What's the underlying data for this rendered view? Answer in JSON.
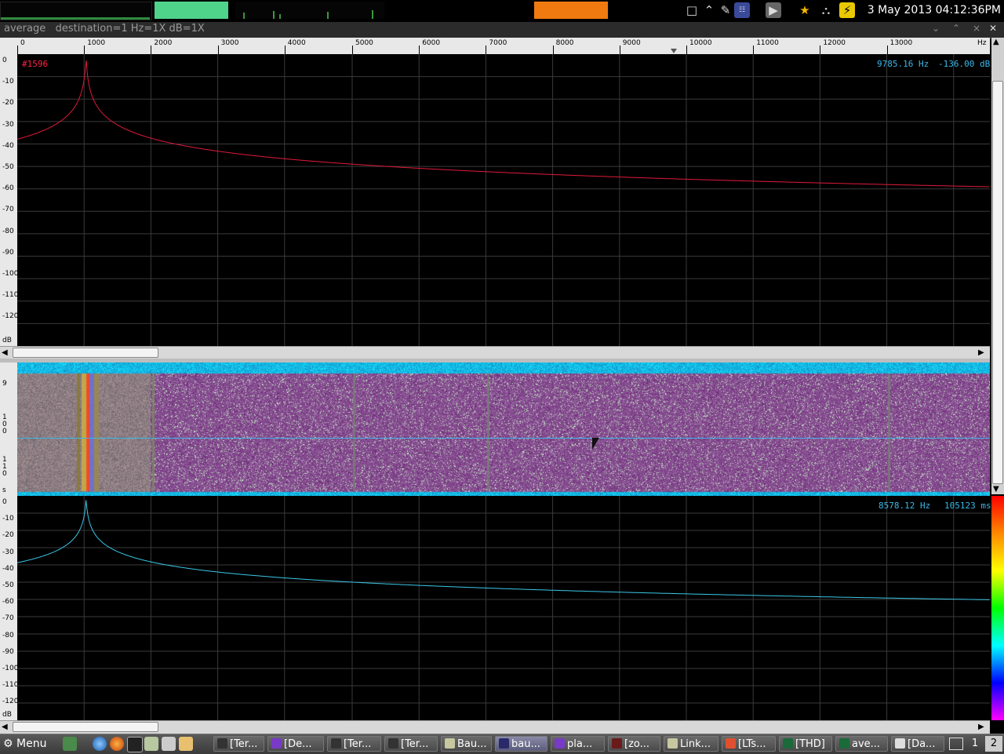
{
  "top_panel": {
    "clock": "3 May 2013 04:12:36PM",
    "tray_icons": [
      "window-icon",
      "chevron-up-icon",
      "pen-icon",
      "network-icon",
      "play-icon",
      "star-icon",
      "shield-icon",
      "power-icon"
    ],
    "accent_green": "#4fd38a",
    "accent_orange": "#f07a10"
  },
  "window": {
    "title": "average   destination=1 Hz=1X dB=1X",
    "buttons": [
      "minimize",
      "maximize",
      "close"
    ]
  },
  "spectrum_top": {
    "trace_label": "#1596",
    "readout_freq": "9785.16 Hz",
    "readout_db": "-136.00 dB",
    "x_ticks": [
      "0",
      "1000",
      "2000",
      "3000",
      "4000",
      "5000",
      "6000",
      "7000",
      "8000",
      "9000",
      "10000",
      "11000",
      "12000",
      "13000"
    ],
    "x_unit": "Hz",
    "y_ticks": [
      "0",
      "-10",
      "-20",
      "-30",
      "-40",
      "-50",
      "-60",
      "-70",
      "-80",
      "-90",
      "-100",
      "-110",
      "-120"
    ],
    "y_unit": "dB",
    "trace_color": "#e01a3a"
  },
  "waterfall": {
    "y_ticks_a": [
      "9",
      "1\n0\n0",
      "1\n1\n0"
    ],
    "y_unit": "s"
  },
  "spectrum_bottom": {
    "readout_freq": "8578.12 Hz",
    "readout_time": "105123 ms",
    "y_ticks": [
      "0",
      "-10",
      "-20",
      "-30",
      "-40",
      "-50",
      "-60",
      "-70",
      "-80",
      "-90",
      "-100",
      "-110",
      "-120"
    ],
    "y_unit": "dB",
    "trace_color": "#3ac8e8"
  },
  "taskbar": {
    "menu_label": "Menu",
    "items": [
      {
        "label": "[Ter...",
        "icon": "terminal-icon"
      },
      {
        "label": "[De...",
        "icon": "play-icon"
      },
      {
        "label": "[Ter...",
        "icon": "terminal-icon"
      },
      {
        "label": "[Ter...",
        "icon": "terminal-icon"
      },
      {
        "label": "Bau...",
        "icon": "folder-icon"
      },
      {
        "label": "bau...",
        "icon": "app-icon"
      },
      {
        "label": "pla...",
        "icon": "play-icon"
      },
      {
        "label": "[zo...",
        "icon": "zotero-icon"
      },
      {
        "label": "Link...",
        "icon": "folder-icon"
      },
      {
        "label": "[LTs...",
        "icon": "browser-icon"
      },
      {
        "label": "[THD]",
        "icon": "chart-icon"
      },
      {
        "label": "ave...",
        "icon": "chart-icon"
      },
      {
        "label": "[Da...",
        "icon": "chat-icon"
      }
    ],
    "workspaces": [
      "1",
      "2"
    ]
  }
}
